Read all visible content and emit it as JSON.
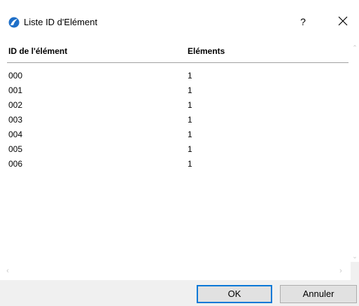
{
  "window": {
    "title": "Liste ID d'Elément",
    "help_label": "?",
    "icon": "archicad-logo-icon"
  },
  "table": {
    "headers": {
      "id": "ID de l'élément",
      "elements": "Eléments"
    },
    "rows": [
      {
        "id": "000",
        "count": "1"
      },
      {
        "id": "001",
        "count": "1"
      },
      {
        "id": "002",
        "count": "1"
      },
      {
        "id": "003",
        "count": "1"
      },
      {
        "id": "004",
        "count": "1"
      },
      {
        "id": "005",
        "count": "1"
      },
      {
        "id": "006",
        "count": "1"
      }
    ]
  },
  "buttons": {
    "ok": "OK",
    "cancel": "Annuler"
  },
  "colors": {
    "accent": "#0078d7",
    "logo": "#1e6fc8"
  }
}
